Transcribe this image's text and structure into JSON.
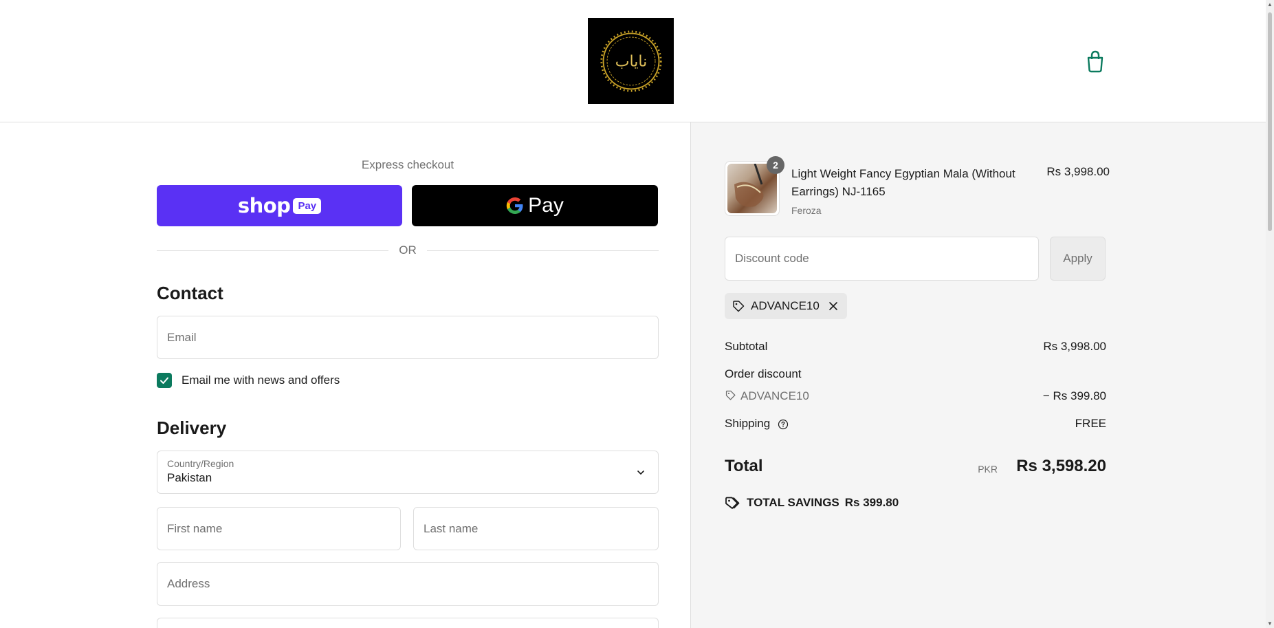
{
  "header": {
    "logo_text": "نایاب",
    "cart_icon": "shopping-bag-icon"
  },
  "express": {
    "label": "Express checkout",
    "shop_pay": {
      "shop": "shop",
      "pay": "Pay"
    },
    "gpay_label": "Pay",
    "or_label": "OR"
  },
  "contact": {
    "title": "Contact",
    "email_placeholder": "Email",
    "newsletter_label": "Email me with news and offers",
    "newsletter_checked": true
  },
  "delivery": {
    "title": "Delivery",
    "country_label": "Country/Region",
    "country_value": "Pakistan",
    "first_name_placeholder": "First name",
    "last_name_placeholder": "Last name",
    "address_placeholder": "Address"
  },
  "summary": {
    "product": {
      "quantity": "2",
      "title": "Light Weight Fancy Egyptian Mala (Without Earrings) NJ-1165",
      "variant": "Feroza",
      "price": "Rs 3,998.00"
    },
    "discount": {
      "placeholder": "Discount code",
      "apply_label": "Apply",
      "applied_code": "ADVANCE10"
    },
    "subtotal_label": "Subtotal",
    "subtotal_value": "Rs 3,998.00",
    "order_discount_label": "Order discount",
    "order_discount_code": "ADVANCE10",
    "order_discount_value": "− Rs 399.80",
    "shipping_label": "Shipping",
    "shipping_value": "FREE",
    "total_label": "Total",
    "total_currency": "PKR",
    "total_value": "Rs 3,598.20",
    "savings_label": "TOTAL SAVINGS",
    "savings_value": "Rs 399.80"
  },
  "colors": {
    "shop_pay": "#5a31f4",
    "accent_green": "#0b7a5e",
    "summary_bg": "#f5f5f5"
  }
}
